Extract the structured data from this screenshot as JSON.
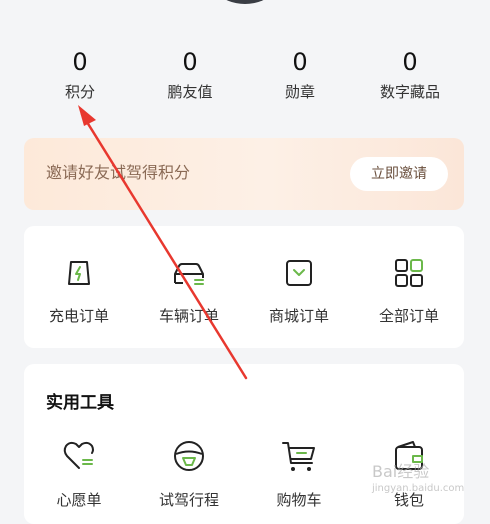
{
  "stats": [
    {
      "value": "0",
      "label": "积分"
    },
    {
      "value": "0",
      "label": "鹏友值"
    },
    {
      "value": "0",
      "label": "勋章"
    },
    {
      "value": "0",
      "label": "数字藏品"
    }
  ],
  "invite": {
    "text": "邀请好友试驾得积分",
    "button": "立即邀请"
  },
  "orders": [
    {
      "label": "充电订单",
      "icon": "charging-order-icon"
    },
    {
      "label": "车辆订单",
      "icon": "vehicle-order-icon"
    },
    {
      "label": "商城订单",
      "icon": "mall-order-icon"
    },
    {
      "label": "全部订单",
      "icon": "all-orders-icon"
    }
  ],
  "tools": {
    "title": "实用工具",
    "items": [
      {
        "label": "心愿单",
        "icon": "wishlist-icon"
      },
      {
        "label": "试驾行程",
        "icon": "steering-wheel-icon"
      },
      {
        "label": "购物车",
        "icon": "cart-icon"
      },
      {
        "label": "钱包",
        "icon": "wallet-icon"
      }
    ]
  },
  "colors": {
    "accent": "#6bb84a",
    "arrow": "#e8382f",
    "invite_text": "#8a6a55"
  },
  "watermark": {
    "logo": "Bai经验",
    "sub": "jingyan.baidu.com"
  }
}
